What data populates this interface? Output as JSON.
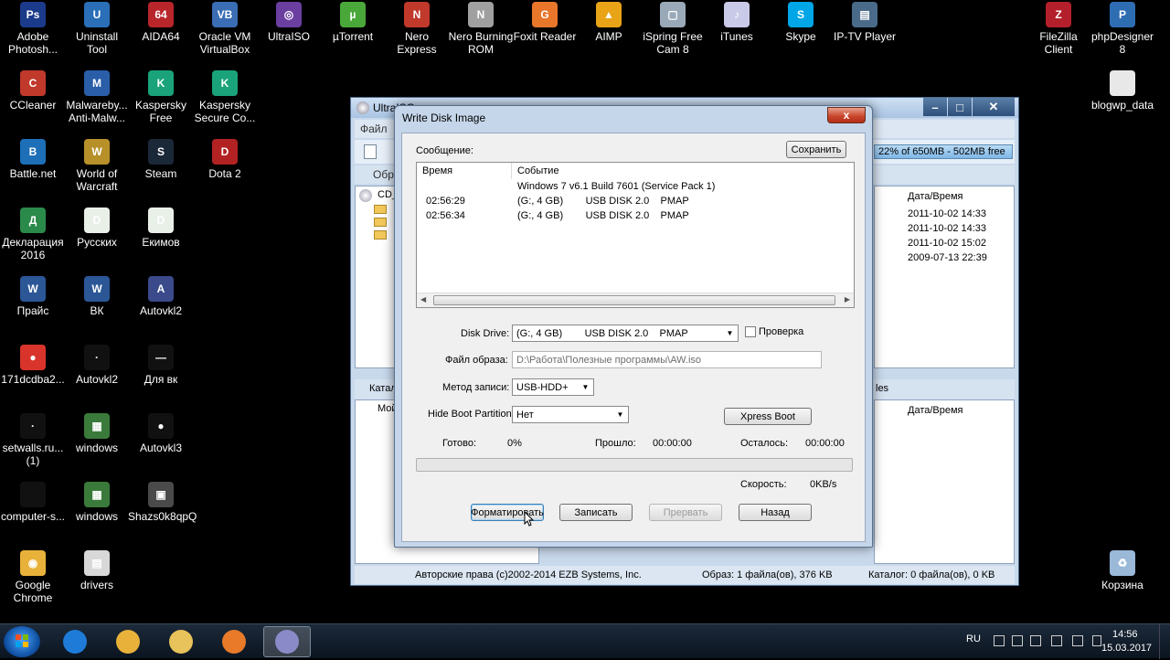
{
  "desktop": {
    "icons": [
      {
        "label": "Adobe\nPhotosh...",
        "icon": "photoshop-icon",
        "color": "#1b3b8a",
        "glyph": "Ps"
      },
      {
        "label": "Uninstall\nTool",
        "icon": "uninstall-tool-icon",
        "color": "#2a6fb8",
        "glyph": "U"
      },
      {
        "label": "AIDA64",
        "icon": "aida64-icon",
        "color": "#b8252b",
        "glyph": "64"
      },
      {
        "label": "Oracle VM\nVirtualBox",
        "icon": "virtualbox-icon",
        "color": "#3a6db3",
        "glyph": "VB"
      },
      {
        "label": "UltraISO",
        "icon": "ultraiso-icon",
        "color": "#6b3fa0",
        "glyph": "◎"
      },
      {
        "label": "µTorrent",
        "icon": "utorrent-icon",
        "color": "#4aa83a",
        "glyph": "µ"
      },
      {
        "label": "Nero Express",
        "icon": "nero-express-icon",
        "color": "#c0392b",
        "glyph": "N"
      },
      {
        "label": "Nero Burning\nROM",
        "icon": "nero-burning-rom-icon",
        "color": "#a0a0a0",
        "glyph": "N"
      },
      {
        "label": "Foxit Reader",
        "icon": "foxit-reader-icon",
        "color": "#e8762b",
        "glyph": "G"
      },
      {
        "label": "AIMP",
        "icon": "aimp-icon",
        "color": "#e8a317",
        "glyph": "▲"
      },
      {
        "label": "iSpring Free\nCam 8",
        "icon": "ispring-icon",
        "color": "#9aa9b8",
        "glyph": "▢"
      },
      {
        "label": "iTunes",
        "icon": "itunes-icon",
        "color": "#c9c9e8",
        "glyph": "♪"
      },
      {
        "label": "Skype",
        "icon": "skype-icon",
        "color": "#00a6e6",
        "glyph": "S"
      },
      {
        "label": "IP-TV Player",
        "icon": "iptv-player-icon",
        "color": "#4a6a8a",
        "glyph": "▤"
      },
      {
        "label": "FileZilla\nClient",
        "icon": "filezilla-icon",
        "color": "#b3202b",
        "glyph": "Z"
      },
      {
        "label": "phpDesigner\n8",
        "icon": "phpdesigner-icon",
        "color": "#2f6db3",
        "glyph": "P"
      },
      {
        "label": "CCleaner",
        "icon": "ccleaner-icon",
        "color": "#c0392b",
        "glyph": "C"
      },
      {
        "label": "Malwareby...\nAnti-Malw...",
        "icon": "malwarebytes-icon",
        "color": "#2a5ea8",
        "glyph": "M"
      },
      {
        "label": "Kaspersky\nFree",
        "icon": "kaspersky-free-icon",
        "color": "#1aa37a",
        "glyph": "K"
      },
      {
        "label": "Kaspersky\nSecure Co...",
        "icon": "kaspersky-secure-icon",
        "color": "#1aa37a",
        "glyph": "K"
      },
      {
        "label": "blogwp_data",
        "icon": "file-icon",
        "color": "#e8e8e8",
        "glyph": ""
      },
      {
        "label": "Battle.net",
        "icon": "battlenet-icon",
        "color": "#1d6fb8",
        "glyph": "B"
      },
      {
        "label": "World of\nWarcraft",
        "icon": "wow-icon",
        "color": "#b8902a",
        "glyph": "W"
      },
      {
        "label": "Steam",
        "icon": "steam-icon",
        "color": "#1b2838",
        "glyph": "S"
      },
      {
        "label": "Dota 2",
        "icon": "dota2-icon",
        "color": "#b22222",
        "glyph": "D"
      },
      {
        "label": "Декларация\n2016",
        "icon": "declaration-icon",
        "color": "#2a8a4a",
        "glyph": "Д"
      },
      {
        "label": "Русских",
        "icon": "document-icon",
        "color": "#e8f0e8",
        "glyph": "D"
      },
      {
        "label": "Екимов",
        "icon": "document-icon",
        "color": "#e8f0e8",
        "glyph": "D"
      },
      {
        "label": "Прайс",
        "icon": "word-doc-icon",
        "color": "#2b5797",
        "glyph": "W"
      },
      {
        "label": "ВК",
        "icon": "word-doc-icon",
        "color": "#2b5797",
        "glyph": "W"
      },
      {
        "label": "Autovkl2",
        "icon": "file-icon",
        "color": "#3a4a8a",
        "glyph": "A"
      },
      {
        "label": "171dcdba2...",
        "icon": "image-icon",
        "color": "#d9342b",
        "glyph": "●"
      },
      {
        "label": "Autovkl2",
        "icon": "file-icon",
        "color": "#111",
        "glyph": "·"
      },
      {
        "label": "Для вк",
        "icon": "file-icon",
        "color": "#111",
        "glyph": "—"
      },
      {
        "label": "setwalls.ru...\n(1)",
        "icon": "image-icon",
        "color": "#111",
        "glyph": "·"
      },
      {
        "label": "windows",
        "icon": "image-icon",
        "color": "#3a7a3a",
        "glyph": "▦"
      },
      {
        "label": "Autovkl3",
        "icon": "image-icon",
        "color": "#111",
        "glyph": "●"
      },
      {
        "label": "computer-s...",
        "icon": "image-icon",
        "color": "#111",
        "glyph": ""
      },
      {
        "label": "windows",
        "icon": "image-icon",
        "color": "#3a7a3a",
        "glyph": "▦"
      },
      {
        "label": "Shazs0k8qpQ",
        "icon": "image-icon",
        "color": "#4a4a4a",
        "glyph": "▣"
      },
      {
        "label": "Google\nChrome",
        "icon": "chrome-icon",
        "color": "#e8b23a",
        "glyph": "◉"
      },
      {
        "label": "drivers",
        "icon": "document-icon",
        "color": "#d8d8d8",
        "glyph": "▤"
      },
      {
        "label": "Корзина",
        "icon": "recycle-bin-icon",
        "color": "#9ab8d8",
        "glyph": "♻"
      }
    ]
  },
  "ultraiso": {
    "title": "UltraISO",
    "menu_file": "Файл",
    "image_tab": "Образ",
    "capacity_text": "22% of 650MB - 502MB free",
    "tree_cd": "CD_",
    "date_header": "Дата/Время",
    "dates": [
      "2011-10-02 14:33",
      "2011-10-02 14:33",
      "2011-10-02 15:02",
      "2009-07-13 22:39"
    ],
    "catalog_tab": "Катал",
    "my_computer": "Мой",
    "files_suffix": "les",
    "date_header2": "Дата/Время",
    "status_copyright": "Авторские права (c)2002-2014 EZB Systems, Inc.",
    "status_image": "Образ: 1 файла(ов), 376 KB",
    "status_catalog": "Каталог: 0 файла(ов), 0 KB"
  },
  "dialog": {
    "title": "Write Disk Image",
    "message_label": "Сообщение:",
    "save_button": "Сохранить",
    "log_headers": {
      "time": "Время",
      "event": "Событие"
    },
    "log_rows": [
      {
        "time": "",
        "event": "Windows 7 v6.1 Build 7601 (Service Pack 1)"
      },
      {
        "time": "02:56:29",
        "event": "(G:, 4 GB)        USB DISK 2.0    PMAP"
      },
      {
        "time": "02:56:34",
        "event": "(G:, 4 GB)        USB DISK 2.0    PMAP"
      }
    ],
    "disk_drive_label": "Disk Drive:",
    "disk_drive_value": "(G:, 4 GB)        USB DISK 2.0    PMAP",
    "verify_label": "Проверка",
    "image_file_label": "Файл образа:",
    "image_file_value": "D:\\Работа\\Полезные программы\\AW.iso",
    "write_method_label": "Метод записи:",
    "write_method_value": "USB-HDD+",
    "hide_boot_label": "Hide Boot Partition:",
    "hide_boot_value": "Нет",
    "xpress_boot_button": "Xpress Boot",
    "done_label": "Готово:",
    "done_value": "0%",
    "elapsed_label": "Прошло:",
    "elapsed_value": "00:00:00",
    "remaining_label": "Осталось:",
    "remaining_value": "00:00:00",
    "progress": 0,
    "speed_label": "Скорость:",
    "speed_value": "0KB/s",
    "format_button": "Форматировать",
    "write_button": "Записать",
    "abort_button": "Прервать",
    "back_button": "Назад",
    "close_glyph": "x"
  },
  "taskbar": {
    "lang": "RU",
    "time": "14:56",
    "date": "15.03.2017",
    "pinned": [
      {
        "icon": "internet-explorer-icon",
        "color": "#1f7bd8"
      },
      {
        "icon": "chrome-icon",
        "color": "#e8b23a"
      },
      {
        "icon": "file-explorer-icon",
        "color": "#e8c25a"
      },
      {
        "icon": "media-player-icon",
        "color": "#e87a2a"
      },
      {
        "icon": "ultraiso-icon",
        "color": "#8a8ac8"
      }
    ]
  }
}
